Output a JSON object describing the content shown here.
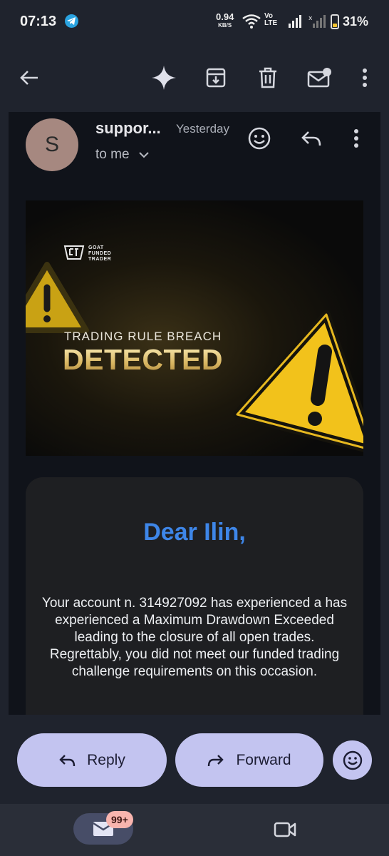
{
  "status_bar": {
    "time": "07:13",
    "net_speed": "0.94",
    "net_unit": "KB/S",
    "volte": "Vo",
    "volte2": "LTE",
    "battery_pct": "31%"
  },
  "toolbar": {
    "icons": [
      "back-arrow-icon",
      "gemini-sparkle-icon",
      "archive-icon",
      "delete-icon",
      "mark-unread-icon",
      "more-vert-icon"
    ]
  },
  "message": {
    "avatar_letter": "S",
    "sender": "suppor...",
    "date": "Yesterday",
    "recipient": "to me"
  },
  "banner": {
    "logo_line1": "GOAT",
    "logo_line2": "FUNDED",
    "logo_line3": "TRADER",
    "subtitle": "TRADING RULE BREACH",
    "title": "DETECTED"
  },
  "card": {
    "greeting": "Dear Ilin,",
    "body": "Your account n. 314927092 has experienced a has experienced a Maximum Drawdown Exceeded leading to the closure of all open trades. Regrettably, you did not meet our funded trading challenge requirements on this occasion."
  },
  "actions": {
    "reply_label": "Reply",
    "forward_label": "Forward"
  },
  "bottom_nav": {
    "mail_badge": "99+"
  },
  "colors": {
    "background": "#1f232d",
    "panel": "#10131a",
    "accent_pill": "#c3c4f0",
    "greeting_blue": "#3e86e8",
    "warning_yellow": "#f2c21b"
  }
}
